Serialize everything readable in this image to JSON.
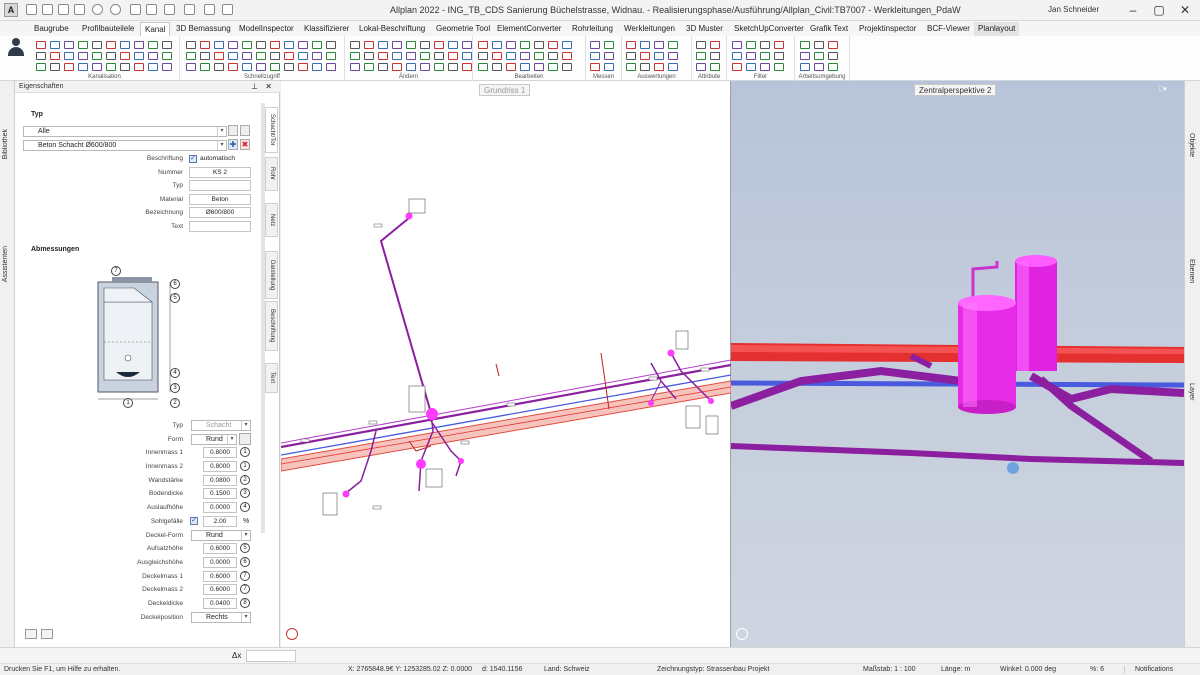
{
  "titlebar": {
    "title": "Allplan 2022 - ING_TB_CDS Sanierung Büchelstrasse, Widnau. - Realisierungsphase/Ausführung/Allplan_Civil:TB7007 - Werkleitungen_PdaW",
    "user": "Jan Schneider"
  },
  "menu_tabs": [
    "Baugrube",
    "Profilbauteilele",
    "Kanal",
    "3D Bemassung",
    "ModelInspector",
    "Klassifizierer",
    "Lokal-Beschriftung",
    "Geometrie Tool",
    "ElementConverter",
    "Rohrleitung",
    "Werkleitungen",
    "3D Muster",
    "SketchUpConverter",
    "Grafik Text",
    "Projektinspector",
    "BCF-Viewer",
    "Planlayout"
  ],
  "ribbon_groups": [
    "Kanalisation",
    "Schnellzugriff",
    "Ändern",
    "Bearbeiten",
    "Messen",
    "Auswertungen",
    "Attribute",
    "Filter",
    "Arbeitsumgebung"
  ],
  "left_strip": {
    "top": "Bibliothek",
    "bottom": "Assistenten"
  },
  "right_strip": {
    "top": "Objekte",
    "mid": "Ebenen",
    "bottom": "Layer"
  },
  "panel": {
    "title": "Eigenschaften",
    "section_typ": "Typ",
    "typ_combo": "Alle",
    "type_combo": "Beton Schacht Ø600/800",
    "rows": [
      {
        "label": "Beschriftung",
        "value": "automatisch"
      },
      {
        "label": "Nummer",
        "value": "KS 2"
      },
      {
        "label": "Typ",
        "value": ""
      },
      {
        "label": "Material",
        "value": "Beton"
      },
      {
        "label": "Bezeichnung",
        "value": "Ø600/800"
      },
      {
        "label": "Text",
        "value": ""
      }
    ],
    "section_abm": "Abmessungen",
    "typ2": {
      "label": "Typ",
      "value": "Schacht"
    },
    "form": {
      "label": "Form",
      "value": "Rund"
    },
    "dims": [
      {
        "label": "Innenmass 1",
        "value": "0.8000",
        "num": "1"
      },
      {
        "label": "Innenmass 2",
        "value": "0.8000",
        "num": "1"
      },
      {
        "label": "Wandstärke",
        "value": "0.0800",
        "num": "2"
      },
      {
        "label": "Bodendicke",
        "value": "0.1500",
        "num": "3"
      },
      {
        "label": "Auslaufhöhe",
        "value": "0.0000",
        "num": "4"
      }
    ],
    "sohlgefaelle": {
      "label": "Sohlgefälle",
      "value": "2.00",
      "unit": "%"
    },
    "deckel_form": {
      "label": "Deckel-Form",
      "value": "Rund"
    },
    "dims2": [
      {
        "label": "Aufsatzhöhe",
        "value": "0.6000",
        "num": "5"
      },
      {
        "label": "Ausgleichshöhe",
        "value": "0.0000",
        "num": "6"
      },
      {
        "label": "Deckelmass 1",
        "value": "0.6000",
        "num": "7"
      },
      {
        "label": "Deckelmass 2",
        "value": "0.6000",
        "num": "7"
      },
      {
        "label": "Deckeldicke",
        "value": "0.0400",
        "num": "8"
      }
    ],
    "deckelposition": {
      "label": "Deckelposition",
      "value": "Rechts"
    },
    "side_tabs": [
      "Schacht/Tor",
      "Rohr",
      "Netz",
      "Darstellung",
      "Beschriftung",
      "Text"
    ],
    "diagram_labels": [
      "7",
      "6",
      "5",
      "4",
      "3",
      "2",
      "1"
    ]
  },
  "viewport2d": {
    "title": "Grundriss 1"
  },
  "viewport3d": {
    "title": "Zentralperspektive 2"
  },
  "bottombar": {
    "dx_label": "Δx"
  },
  "statusbar": {
    "help": "Drucken Sie F1, um Hilfe zu erhalten.",
    "x": "X: 2765848.9€ Y: 1253285.02 Z: 0.0000",
    "d": "d: 1540.1156",
    "land": "Land: Schweiz",
    "zeichnungstyp": "Zeichnungstyp: Strassenbau Projekt",
    "massstab": "Maßstab: 1 : 100",
    "laenge": "Länge: m",
    "winkel": "Winkel: 0.000 deg",
    "percent": "%: 6",
    "notifications": "Notifications"
  },
  "colors": {
    "pipe_red": "#e53030",
    "pipe_blue": "#4a5adf",
    "pipe_purple": "#8b1fa0",
    "shaft_magenta": "#ff3aff",
    "accent": "#2a5faa"
  }
}
